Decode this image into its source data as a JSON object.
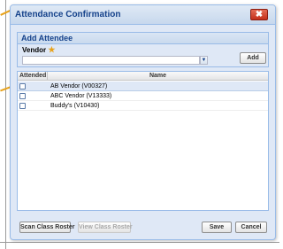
{
  "window": {
    "title": "Attendance Confirmation",
    "close_glyph": "✖"
  },
  "add_attendee": {
    "title": "Add Attendee",
    "vendor_label": "Vendor",
    "required_icon": "★",
    "vendor_value": "",
    "combo_trigger_glyph": "▼",
    "add_label": "Add"
  },
  "grid": {
    "columns": [
      "Attended",
      "Name"
    ],
    "rows": [
      {
        "attended": false,
        "name": "AB Vendor (V00327)",
        "selected": true
      },
      {
        "attended": false,
        "name": "ABC Vendor (V13333)",
        "selected": false
      },
      {
        "attended": false,
        "name": "Buddy's  (V10430)",
        "selected": false
      }
    ]
  },
  "footer": {
    "scan_label": "Scan Class Roster",
    "view_label": "View Class Roster",
    "save_label": "Save",
    "cancel_label": "Cancel"
  },
  "colors": {
    "accent": "#15428b",
    "callout": "#e8a21a",
    "close": "#c4301b"
  }
}
